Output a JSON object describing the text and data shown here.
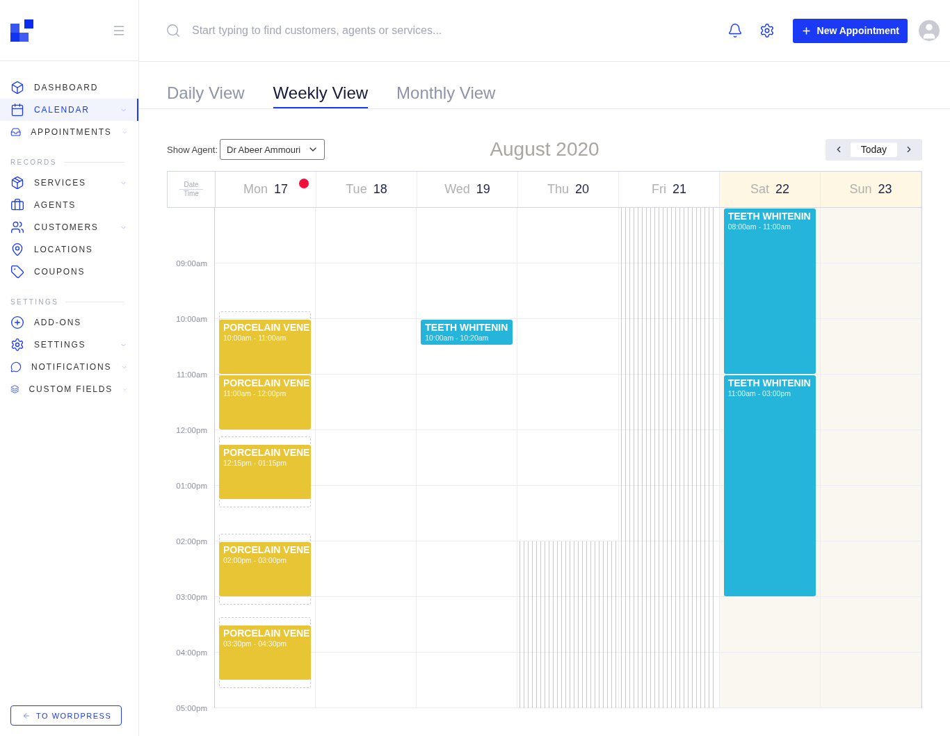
{
  "sidebar": {
    "sections": [
      {
        "items": [
          {
            "label": "DASHBOARD",
            "selected": false,
            "has_submenu": false
          },
          {
            "label": "CALENDAR",
            "selected": true,
            "has_submenu": true
          },
          {
            "label": "APPOINTMENTS",
            "selected": false,
            "has_submenu": true
          }
        ]
      },
      {
        "heading": "RECORDS",
        "items": [
          {
            "label": "SERVICES",
            "selected": false,
            "has_submenu": true
          },
          {
            "label": "AGENTS",
            "selected": false,
            "has_submenu": false
          },
          {
            "label": "CUSTOMERS",
            "selected": false,
            "has_submenu": true
          },
          {
            "label": "LOCATIONS",
            "selected": false,
            "has_submenu": false
          },
          {
            "label": "COUPONS",
            "selected": false,
            "has_submenu": false
          }
        ]
      },
      {
        "heading": "SETTINGS",
        "items": [
          {
            "label": "ADD-ONS",
            "selected": false,
            "has_submenu": false
          },
          {
            "label": "SETTINGS",
            "selected": false,
            "has_submenu": true
          },
          {
            "label": "NOTIFICATIONS",
            "selected": false,
            "has_submenu": true
          },
          {
            "label": "CUSTOM FIELDS",
            "selected": false,
            "has_submenu": true
          }
        ]
      }
    ],
    "footer_button": "TO WORDPRESS"
  },
  "topbar": {
    "search": {
      "placeholder": "Start typing to find customers, agents or services..."
    },
    "new_button": "New Appointment"
  },
  "tabs": [
    {
      "label": "Daily View",
      "selected": false
    },
    {
      "label": "Weekly View",
      "selected": true
    },
    {
      "label": "Monthly View",
      "selected": false
    }
  ],
  "calendar": {
    "agent_label": "Show Agent:",
    "agent": "Dr Abeer Ammouri",
    "title": "August 2020",
    "today_button": "Today",
    "corner": {
      "top": "Date",
      "bottom": "Time"
    },
    "times": [
      "09:00am",
      "10:00am",
      "11:00am",
      "12:00pm",
      "01:00pm",
      "02:00pm",
      "03:00pm",
      "04:00pm",
      "05:00pm"
    ],
    "days": [
      {
        "weekday": "Mon",
        "date": "17",
        "kind": "open",
        "today": true,
        "weekend": false,
        "events": [
          {
            "title": "PORCELAIN VENE",
            "time": "10:00am - 11:00am",
            "color": "#e8c534",
            "buffer": true
          },
          {
            "title": "PORCELAIN VENE",
            "time": "11:00am - 12:00pm",
            "color": "#e8c534",
            "buffer": false
          },
          {
            "title": "PORCELAIN VENE",
            "time": "12:15pm - 01:15pm",
            "color": "#e8c534",
            "buffer": true
          },
          {
            "title": "PORCELAIN VENE",
            "time": "02:00pm - 03:00pm",
            "color": "#e8c534",
            "buffer": true
          },
          {
            "title": "PORCELAIN VENE",
            "time": "03:30pm - 04:30pm",
            "color": "#e8c534",
            "buffer": true
          }
        ]
      },
      {
        "weekday": "Tue",
        "date": "18",
        "kind": "open",
        "today": false,
        "weekend": false
      },
      {
        "weekday": "Wed",
        "date": "19",
        "kind": "open",
        "today": false,
        "weekend": false,
        "events": [
          {
            "title": "TEETH WHITENIN",
            "time": "10:00am - 10:20am",
            "color": "#25b5da",
            "buffer": false
          }
        ]
      },
      {
        "weekday": "Thu",
        "date": "20",
        "kind": "halfday",
        "today": false,
        "weekend": false
      },
      {
        "weekday": "Fri",
        "date": "21",
        "kind": "closed",
        "today": false,
        "weekend": false
      },
      {
        "weekday": "Sat",
        "date": "22",
        "kind": "open",
        "today": false,
        "weekend": true,
        "events": [
          {
            "title": "TEETH WHITENIN",
            "time": "08:00am - 11:00am",
            "color": "#25b5da",
            "buffer": false
          },
          {
            "title": "TEETH WHITENIN",
            "time": "11:00am - 03:00pm",
            "color": "#25b5da",
            "buffer": false
          }
        ]
      },
      {
        "weekday": "Sun",
        "date": "23",
        "kind": "open",
        "today": false,
        "weekend": true
      }
    ]
  }
}
